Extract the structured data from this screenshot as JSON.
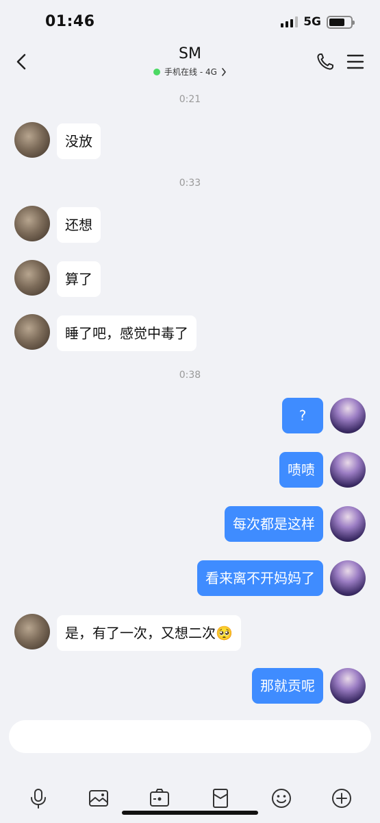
{
  "status": {
    "time": "01:46",
    "network": "5G"
  },
  "header": {
    "title": "SM",
    "subtitle": "手机在线 - 4G"
  },
  "icons": {
    "back": "chevron-left-icon",
    "call": "phone-icon",
    "menu": "hamburger-menu-icon",
    "toolbar": [
      "microphone-icon",
      "image-icon",
      "camera-icon",
      "red-packet-icon",
      "emoji-icon",
      "plus-icon"
    ]
  },
  "colors": {
    "my_bubble": "#3f8cff",
    "their_bubble": "#ffffff",
    "online_dot": "#4cd964",
    "background": "#f1f2f6"
  },
  "messages": {
    "t1": "0:21",
    "m1": "没放",
    "t2": "0:33",
    "m2": "还想",
    "m3": "算了",
    "m4": "睡了吧，感觉中毒了",
    "t3": "0:38",
    "m5": "?",
    "m6": "啧啧",
    "m7": "每次都是这样",
    "m8": "看来离不开妈妈了",
    "m9": "是，有了一次，又想二次🥺",
    "m10": "那就贡呢"
  },
  "input": {
    "placeholder": ""
  }
}
